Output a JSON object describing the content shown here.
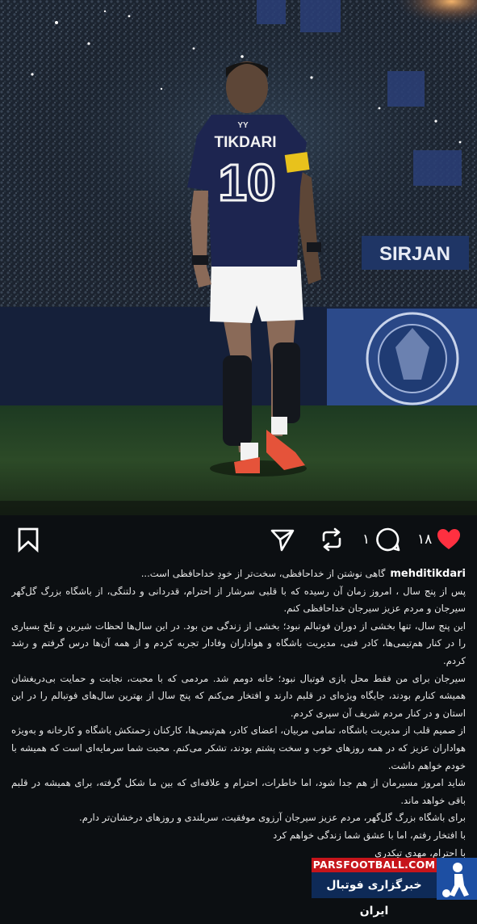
{
  "photo": {
    "jersey_name": "TIKDARI",
    "jersey_number": "10",
    "jersey_crest": "YY",
    "ad_board": "SIRJAN"
  },
  "actions": {
    "likes_count": "۱۸",
    "comments_count": "۱",
    "icons": [
      "heart-icon",
      "comment-icon",
      "repost-icon",
      "share-icon",
      "bookmark-icon"
    ],
    "like_color": "#ff3040"
  },
  "caption": {
    "username": "mehditikdari",
    "paragraphs": [
      "گاهی نوشتن از خداحافظی، سخت‌تر از خودِ خداحافظی است...",
      "پس از پنج سال ، امروز زمان آن رسیده که با قلبی سرشار از احترام، قدردانی و دلتنگی، از باشگاه بزرگ گل‌گهر سیرجان و مردم عزیز سیرجان خداحافظی کنم.",
      "این پنج سال، تنها بخشی از دوران فوتبالم نبود؛ بخشی از زندگی من بود. در این سال‌ها لحظات شیرین و تلخ بسیاری را در کنار هم‌تیمی‌ها، کادر فنی، مدیریت باشگاه و هواداران وفادار تجربه کردم و از همه آن‌ها درس گرفتم و رشد کردم.",
      "سیرجان برای من فقط محل بازی فوتبال نبود؛ خانه دومم شد. مردمی که با محبت، نجابت و حمایت بی‌دریغشان همیشه کنارم بودند، جایگاه ویژه‌ای در قلبم دارند و افتخار می‌کنم که پنج سال از بهترین سال‌های فوتبالم را در این استان و در کنار مردم شریف آن سپری کردم.",
      "از صمیم قلب از مدیریت باشگاه، تمامی مربیان، اعضای کادر، هم‌تیمی‌ها، کارکنان زحمتکش باشگاه و کارخانه و به‌ویژه هواداران عزیز که در همه روزهای خوب و سخت پشتم بودند، تشکر می‌کنم. محبت شما سرمایه‌ای است که همیشه با خودم خواهم داشت.",
      "شاید امروز مسیرمان از هم جدا شود، اما خاطرات، احترام و علاقه‌ای که بین ما شکل گرفته، برای همیشه در قلبم باقی خواهد ماند.",
      "برای باشگاه بزرگ گل‌گهر، مردم عزیز سیرجان آرزوی موفقیت، سربلندی و روزهای درخشان‌تر دارم.",
      "با افتخار رفتم، اما با عشق شما زندگی خواهم کرد",
      "با احترام، مهدی تیکدری"
    ]
  },
  "watermark": {
    "site": "PARSFOOTBALL.COM",
    "tagline": "خبرگزاری فوتبال ایران"
  }
}
